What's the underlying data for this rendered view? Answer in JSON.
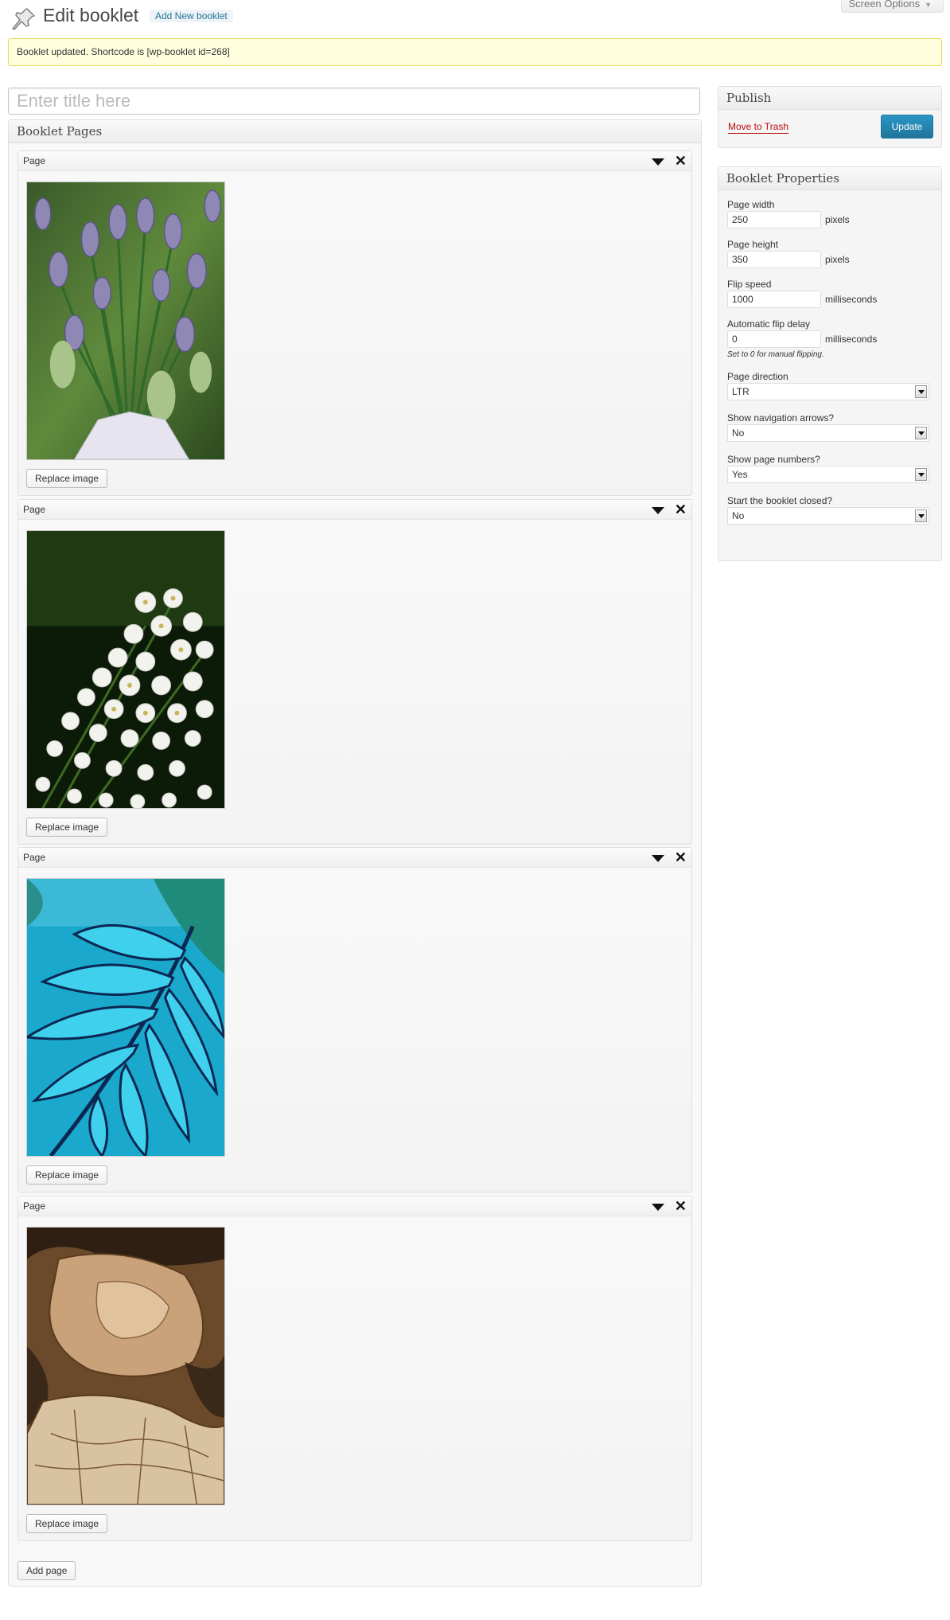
{
  "header": {
    "title": "Edit booklet",
    "add_new_label": "Add New booklet",
    "screen_options_label": "Screen Options"
  },
  "notice": {
    "message": "Booklet updated. Shortcode is [wp-booklet id=268]"
  },
  "title_field": {
    "placeholder": "Enter title here",
    "value": ""
  },
  "booklet_pages": {
    "heading": "Booklet Pages",
    "pages": [
      {
        "label": "Page",
        "image": "purple-buds-photo",
        "button": "Replace image"
      },
      {
        "label": "Page",
        "image": "white-flowers-photo",
        "button": "Replace image"
      },
      {
        "label": "Page",
        "image": "blue-fern-fabric-photo",
        "button": "Replace image"
      },
      {
        "label": "Page",
        "image": "rock-texture-photo",
        "button": "Replace image"
      }
    ],
    "add_page_label": "Add page"
  },
  "publish": {
    "heading": "Publish",
    "trash_label": "Move to Trash",
    "update_label": "Update"
  },
  "properties": {
    "heading": "Booklet Properties",
    "page_width": {
      "label": "Page width",
      "value": "250",
      "unit": "pixels"
    },
    "page_height": {
      "label": "Page height",
      "value": "350",
      "unit": "pixels"
    },
    "flip_speed": {
      "label": "Flip speed",
      "value": "1000",
      "unit": "milliseconds"
    },
    "flip_delay": {
      "label": "Automatic flip delay",
      "value": "0",
      "unit": "milliseconds",
      "hint": "Set to 0 for manual flipping."
    },
    "page_direction": {
      "label": "Page direction",
      "value": "LTR"
    },
    "nav_arrows": {
      "label": "Show navigation arrows?",
      "value": "No"
    },
    "page_numbers": {
      "label": "Show page numbers?",
      "value": "Yes"
    },
    "start_closed": {
      "label": "Start the booklet closed?",
      "value": "No"
    }
  },
  "colors": {
    "accent": "#21759b",
    "notice_bg": "#ffffe0",
    "trash": "#bc0b0b"
  }
}
